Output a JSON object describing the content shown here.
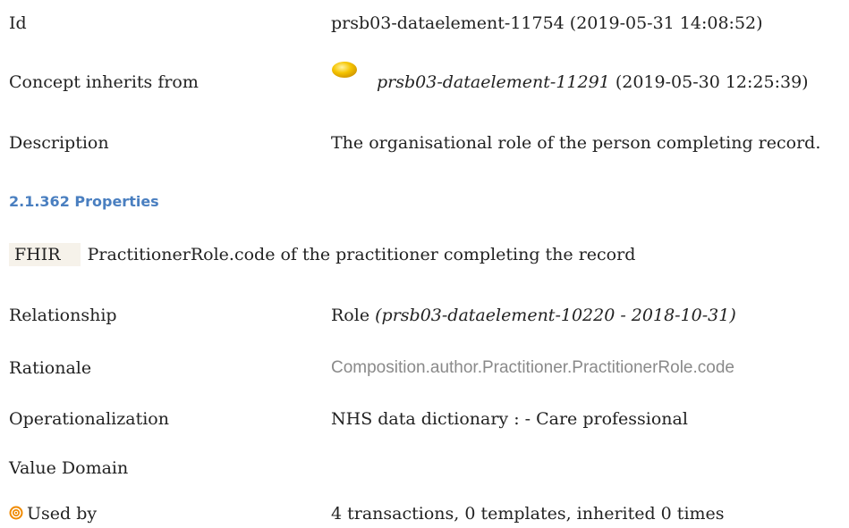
{
  "rows": {
    "id": {
      "label": "Id",
      "value": "prsb03-dataelement-11754 (2019-05-31 14:08:52)"
    },
    "inherits": {
      "label": "Concept inherits from",
      "ref": "prsb03-dataelement-11291",
      "date": "(2019-05-30 12:25:39)"
    },
    "description": {
      "label": "Description",
      "value": "The organisational role of the person completing record."
    }
  },
  "section": {
    "heading": "2.1.362 Properties"
  },
  "fhir": {
    "badge": "FHIR",
    "text": "PractitionerRole.code of the practitioner completing the record"
  },
  "properties": {
    "relationship": {
      "label": "Relationship",
      "value": "Role",
      "ref": "(prsb03-dataelement-10220 - 2018-10-31)"
    },
    "rationale": {
      "label": "Rationale",
      "value": "Composition.author.Practitioner.PractitionerRole.code"
    },
    "operationalization": {
      "label": "Operationalization",
      "value": "NHS data dictionary : - Care professional"
    },
    "value_domain": {
      "label": "Value Domain"
    },
    "used_by": {
      "label": "Used by",
      "value": "4 transactions, 0 templates, inherited 0 times"
    }
  },
  "icons": {
    "inherit": "yellow-ball-icon",
    "used_by": "target-icon"
  },
  "colors": {
    "heading": "#4a7fc0",
    "badge_bg": "#f6f2ea",
    "ball": "#f5c400",
    "target": "#f08a00"
  }
}
